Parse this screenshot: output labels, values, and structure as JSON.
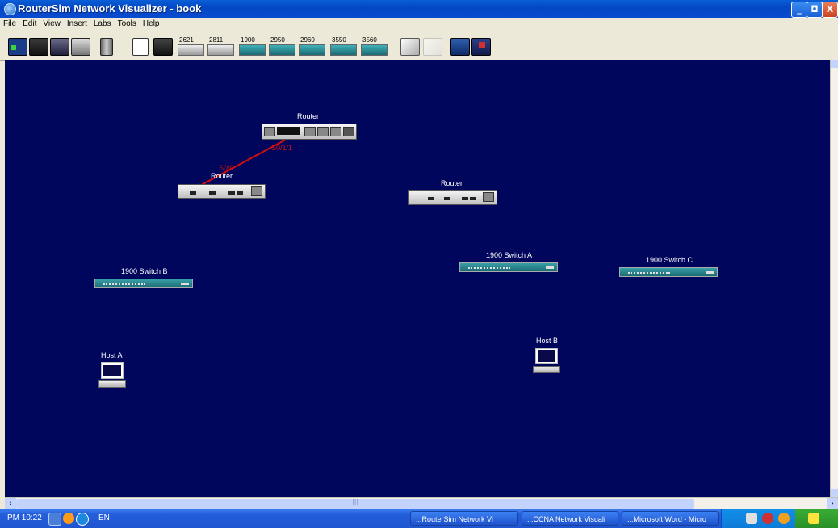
{
  "window": {
    "title": "RouterSim Network Visualizer - book",
    "buttons": {
      "minimize": "_",
      "restore": "◘",
      "close": "X"
    }
  },
  "menu": [
    "File",
    "Edit",
    "View",
    "Insert",
    "Labs",
    "Tools",
    "Help"
  ],
  "toolbar": {
    "device_labels": [
      "2621",
      "2811",
      "1900",
      "2950",
      "2960",
      "3550",
      "3560"
    ]
  },
  "topology": {
    "routers": [
      {
        "label": "Router"
      },
      {
        "label": "Router"
      },
      {
        "label": "Router"
      }
    ],
    "link_labels": {
      "near_top": "S0/1/1",
      "near_left": "S0/0"
    },
    "switches": [
      {
        "label": "1900 Switch B"
      },
      {
        "label": "1900 Switch A"
      },
      {
        "label": "1900 Switch C"
      }
    ],
    "hosts": [
      {
        "label": "Host A"
      },
      {
        "label": "Host B"
      }
    ]
  },
  "taskbar": {
    "time": "PM 10:22",
    "lang": "EN",
    "items": [
      "...RouterSim Network Vi",
      "...CCNA Network Visuali",
      "...Microsoft Word - Micro"
    ]
  },
  "colors": {
    "canvas": "#00065c",
    "link": "#d01010",
    "switch": "#2a8a93"
  }
}
